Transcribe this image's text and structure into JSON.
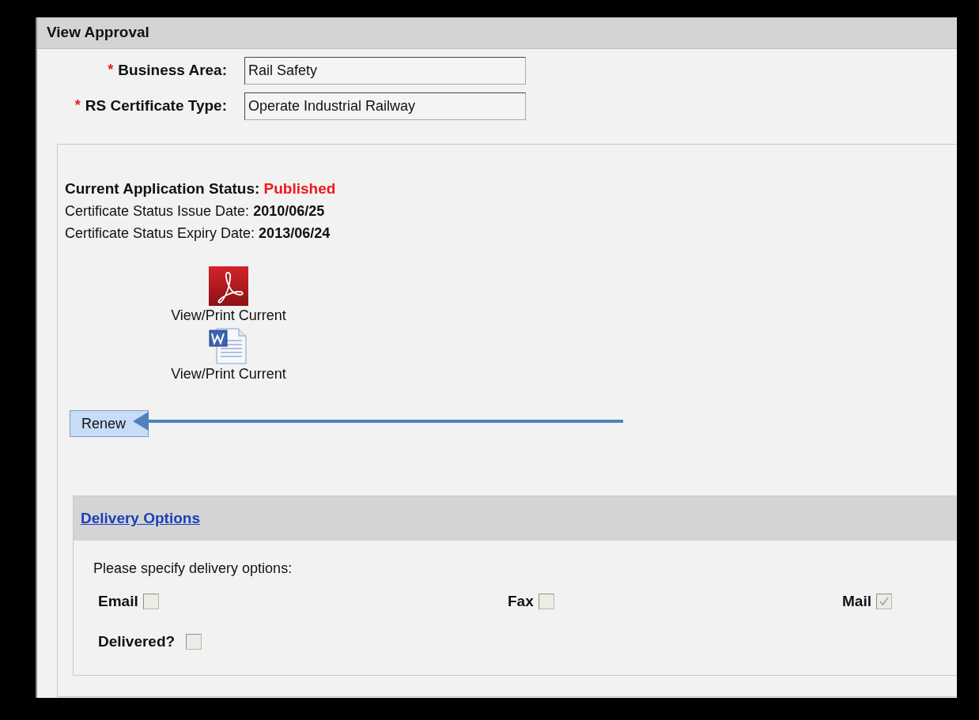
{
  "header": {
    "title": "View Approval"
  },
  "fields": [
    {
      "required_mark": "*",
      "label": "Business Area:",
      "value": "Rail Safety"
    },
    {
      "required_mark": "*",
      "label": "RS Certificate Type:",
      "value": "Operate Industrial Railway"
    }
  ],
  "status": {
    "label": "Current Application Status:",
    "value": "Published",
    "issue_label": "Certificate Status Issue Date:",
    "issue_date": "2010/06/25",
    "expiry_label": "Certificate Status Expiry Date:",
    "expiry_date": "2013/06/24"
  },
  "documents": [
    {
      "kind": "pdf",
      "label": "View/Print Current"
    },
    {
      "kind": "word",
      "label": "View/Print Current"
    }
  ],
  "renew_button": "Renew",
  "delivery": {
    "title": "Delivery Options",
    "prompt": "Please specify delivery options:",
    "options": [
      {
        "label": "Email",
        "checked": false
      },
      {
        "label": "Fax",
        "checked": false
      },
      {
        "label": "Mail",
        "checked": true
      }
    ],
    "delivered": {
      "label": "Delivered?",
      "checked": false
    }
  }
}
